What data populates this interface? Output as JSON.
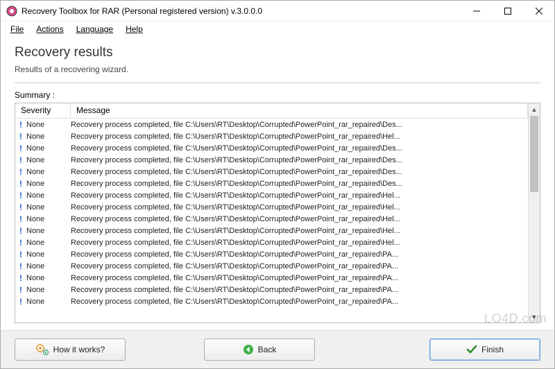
{
  "titlebar": {
    "title": "Recovery Toolbox for RAR (Personal registered version) v.3.0.0.0"
  },
  "menu": {
    "file": "File",
    "actions": "Actions",
    "language": "Language",
    "help": "Help"
  },
  "main": {
    "heading": "Recovery results",
    "subheading": "Results of a recovering wizard.",
    "summary_label": "Summary :",
    "columns": {
      "severity": "Severity",
      "message": "Message"
    },
    "rows": [
      {
        "severity": "None",
        "message": "Recovery process completed, file C:\\Users\\RT\\Desktop\\Corrupted\\PowerPoint_rar_repaired\\Des..."
      },
      {
        "severity": "None",
        "message": "Recovery process completed, file C:\\Users\\RT\\Desktop\\Corrupted\\PowerPoint_rar_repaired\\Hel..."
      },
      {
        "severity": "None",
        "message": "Recovery process completed, file C:\\Users\\RT\\Desktop\\Corrupted\\PowerPoint_rar_repaired\\Des..."
      },
      {
        "severity": "None",
        "message": "Recovery process completed, file C:\\Users\\RT\\Desktop\\Corrupted\\PowerPoint_rar_repaired\\Des..."
      },
      {
        "severity": "None",
        "message": "Recovery process completed, file C:\\Users\\RT\\Desktop\\Corrupted\\PowerPoint_rar_repaired\\Des..."
      },
      {
        "severity": "None",
        "message": "Recovery process completed, file C:\\Users\\RT\\Desktop\\Corrupted\\PowerPoint_rar_repaired\\Des..."
      },
      {
        "severity": "None",
        "message": "Recovery process completed, file C:\\Users\\RT\\Desktop\\Corrupted\\PowerPoint_rar_repaired\\Hel..."
      },
      {
        "severity": "None",
        "message": "Recovery process completed, file C:\\Users\\RT\\Desktop\\Corrupted\\PowerPoint_rar_repaired\\Hel..."
      },
      {
        "severity": "None",
        "message": "Recovery process completed, file C:\\Users\\RT\\Desktop\\Corrupted\\PowerPoint_rar_repaired\\Hel..."
      },
      {
        "severity": "None",
        "message": "Recovery process completed, file C:\\Users\\RT\\Desktop\\Corrupted\\PowerPoint_rar_repaired\\Hel..."
      },
      {
        "severity": "None",
        "message": "Recovery process completed, file C:\\Users\\RT\\Desktop\\Corrupted\\PowerPoint_rar_repaired\\Hel..."
      },
      {
        "severity": "None",
        "message": "Recovery process completed, file C:\\Users\\RT\\Desktop\\Corrupted\\PowerPoint_rar_repaired\\PA..."
      },
      {
        "severity": "None",
        "message": "Recovery process completed, file C:\\Users\\RT\\Desktop\\Corrupted\\PowerPoint_rar_repaired\\PA..."
      },
      {
        "severity": "None",
        "message": "Recovery process completed, file C:\\Users\\RT\\Desktop\\Corrupted\\PowerPoint_rar_repaired\\PA..."
      },
      {
        "severity": "None",
        "message": "Recovery process completed, file C:\\Users\\RT\\Desktop\\Corrupted\\PowerPoint_rar_repaired\\PA..."
      },
      {
        "severity": "None",
        "message": "Recovery process completed, file C:\\Users\\RT\\Desktop\\Corrupted\\PowerPoint_rar_repaired\\PA..."
      }
    ]
  },
  "buttons": {
    "how_it_works": "How it works?",
    "back": "Back",
    "finish": "Finish"
  },
  "watermark": "LO4D.com"
}
